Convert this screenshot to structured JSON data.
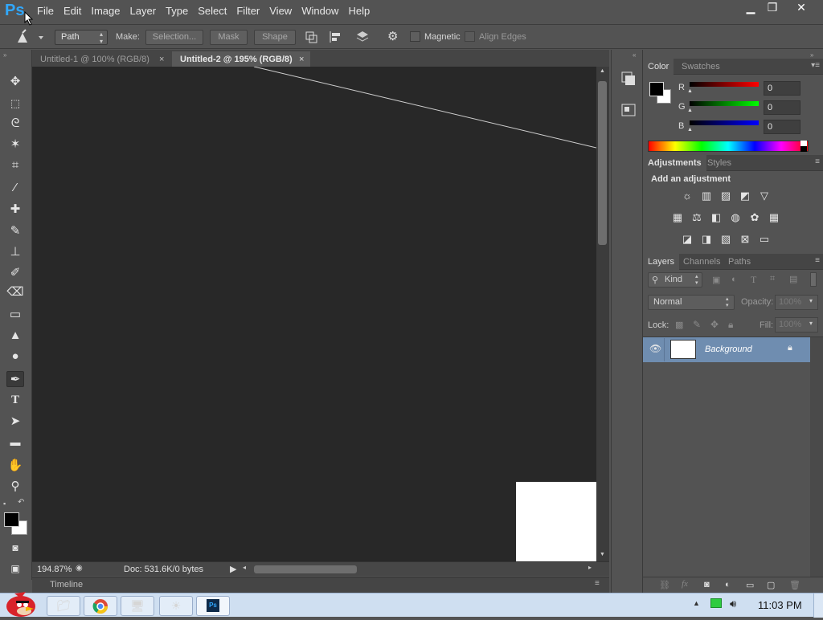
{
  "app": {
    "logo": "Ps",
    "menu": [
      "File",
      "Edit",
      "Image",
      "Layer",
      "Type",
      "Select",
      "Filter",
      "View",
      "Window",
      "Help"
    ],
    "window_controls": {
      "minimize": "▁",
      "restore": "❐",
      "close": "✕"
    }
  },
  "options": {
    "mode_value": "Path",
    "make_label": "Make:",
    "selection_btn": "Selection...",
    "mask_btn": "Mask",
    "shape_btn": "Shape",
    "magnetic_label": "Magnetic",
    "align_edges_label": "Align Edges"
  },
  "tabs": [
    {
      "label": "Untitled-1 @ 100% (RGB/8)",
      "active": false
    },
    {
      "label": "Untitled-2 @ 195% (RGB/8)",
      "active": true
    }
  ],
  "status": {
    "zoom": "194.87%",
    "doc": "Doc: 531.6K/0 bytes"
  },
  "timeline_label": "Timeline",
  "color_panel": {
    "tabs": [
      "Color",
      "Swatches"
    ],
    "r_label": "R",
    "g_label": "G",
    "b_label": "B",
    "r_value": "0",
    "g_value": "0",
    "b_value": "0"
  },
  "adjustments_panel": {
    "tabs": [
      "Adjustments",
      "Styles"
    ],
    "heading": "Add an adjustment"
  },
  "layers_panel": {
    "tabs": [
      "Layers",
      "Channels",
      "Paths"
    ],
    "filter_kind": "Kind",
    "blend_mode": "Normal",
    "opacity_label": "Opacity:",
    "opacity_value": "100%",
    "lock_label": "Lock:",
    "fill_label": "Fill:",
    "fill_value": "100%",
    "layers": [
      {
        "name": "Background",
        "locked": true,
        "visible": true
      }
    ]
  },
  "taskbar": {
    "clock": "11:03 PM"
  },
  "colors": {
    "accent": "#31a8ff",
    "canvas": "#282828",
    "panel": "#535353",
    "layer_selected": "#6f8db0"
  }
}
